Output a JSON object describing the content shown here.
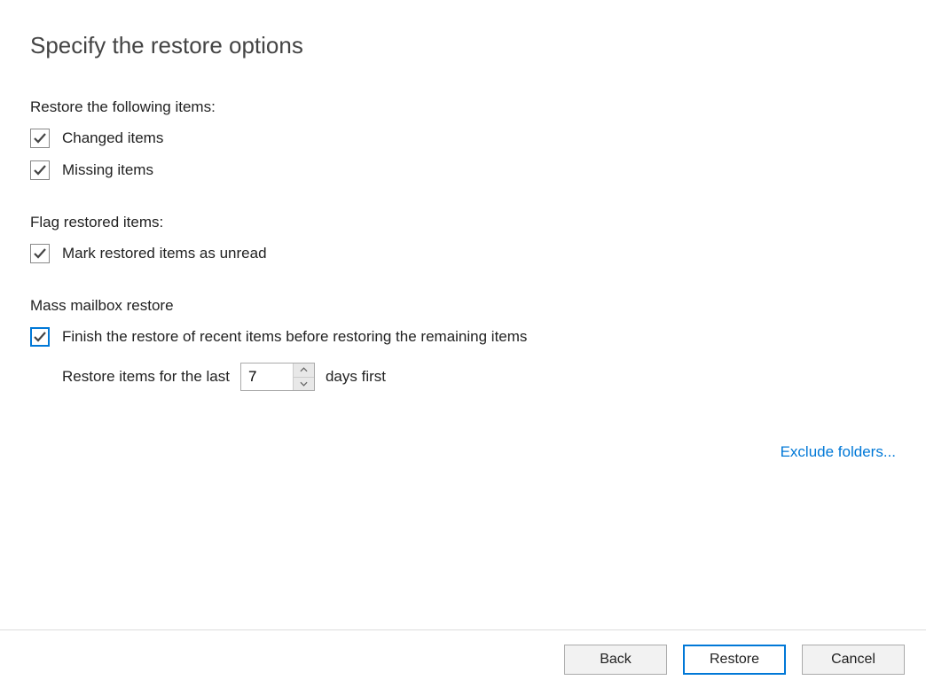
{
  "title": "Specify the restore options",
  "sections": {
    "restore_items": {
      "label": "Restore the following items:",
      "opt_changed": {
        "label": "Changed items",
        "checked": true
      },
      "opt_missing": {
        "label": "Missing items",
        "checked": true
      }
    },
    "flag_restored": {
      "label": "Flag restored items:",
      "opt_unread": {
        "label": "Mark restored items as unread",
        "checked": true
      }
    },
    "mass_restore": {
      "label": "Mass mailbox restore",
      "opt_finish_recent": {
        "label": "Finish the restore of recent items before restoring the remaining items",
        "checked": true
      },
      "sub": {
        "prefix": "Restore items for the last",
        "days_value": "7",
        "suffix": "days first"
      }
    }
  },
  "exclude_link": "Exclude folders...",
  "footer": {
    "back": "Back",
    "restore": "Restore",
    "cancel": "Cancel"
  }
}
